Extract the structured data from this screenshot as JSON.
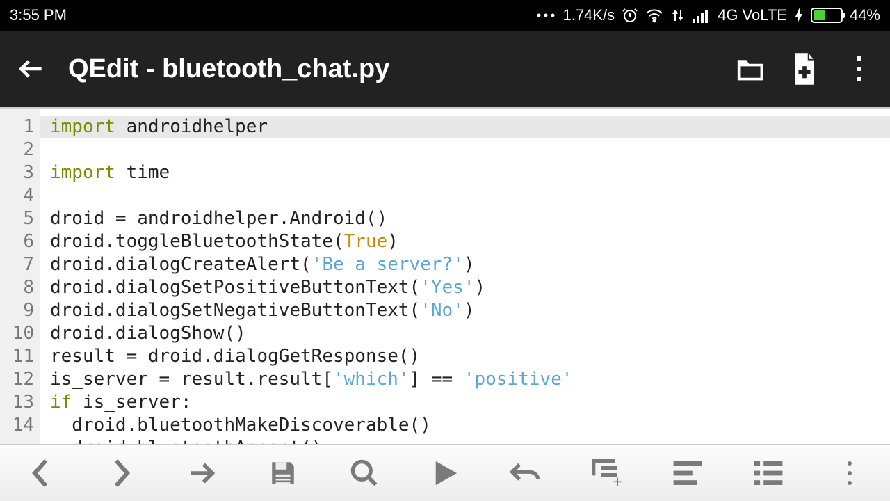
{
  "status": {
    "time": "3:55 PM",
    "speed": "1.74K/s",
    "network_label": "4G VoLTE",
    "battery_pct": "44%",
    "battery_fill_pct": 44
  },
  "appbar": {
    "title": "QEdit - bluetooth_chat.py"
  },
  "code": {
    "lines": [
      {
        "n": 1,
        "segments": [
          {
            "t": "import",
            "c": "kw"
          },
          {
            "t": " androidhelper",
            "c": ""
          }
        ],
        "hl": true
      },
      {
        "n": 2,
        "segments": [
          {
            "t": "import",
            "c": "kw"
          },
          {
            "t": " time",
            "c": ""
          }
        ]
      },
      {
        "n": 3,
        "segments": [
          {
            "t": "",
            "c": ""
          }
        ]
      },
      {
        "n": 4,
        "segments": [
          {
            "t": "droid = androidhelper.Android()",
            "c": ""
          }
        ]
      },
      {
        "n": 5,
        "segments": [
          {
            "t": "droid.toggleBluetoothState(",
            "c": ""
          },
          {
            "t": "True",
            "c": "bool"
          },
          {
            "t": ")",
            "c": ""
          }
        ]
      },
      {
        "n": 6,
        "segments": [
          {
            "t": "droid.dialogCreateAlert(",
            "c": ""
          },
          {
            "t": "'Be a server?'",
            "c": "str"
          },
          {
            "t": ")",
            "c": ""
          }
        ]
      },
      {
        "n": 7,
        "segments": [
          {
            "t": "droid.dialogSetPositiveButtonText(",
            "c": ""
          },
          {
            "t": "'Yes'",
            "c": "str"
          },
          {
            "t": ")",
            "c": ""
          }
        ]
      },
      {
        "n": 8,
        "segments": [
          {
            "t": "droid.dialogSetNegativeButtonText(",
            "c": ""
          },
          {
            "t": "'No'",
            "c": "str"
          },
          {
            "t": ")",
            "c": ""
          }
        ]
      },
      {
        "n": 9,
        "segments": [
          {
            "t": "droid.dialogShow()",
            "c": ""
          }
        ]
      },
      {
        "n": 10,
        "segments": [
          {
            "t": "result = droid.dialogGetResponse()",
            "c": ""
          }
        ]
      },
      {
        "n": 11,
        "segments": [
          {
            "t": "is_server = result.result[",
            "c": ""
          },
          {
            "t": "'which'",
            "c": "str"
          },
          {
            "t": "] == ",
            "c": ""
          },
          {
            "t": "'positive'",
            "c": "str"
          }
        ]
      },
      {
        "n": 12,
        "segments": [
          {
            "t": "if",
            "c": "kw"
          },
          {
            "t": " is_server:",
            "c": ""
          }
        ]
      },
      {
        "n": 13,
        "segments": [
          {
            "t": "  droid.bluetoothMakeDiscoverable()",
            "c": ""
          }
        ]
      },
      {
        "n": 14,
        "segments": [
          {
            "t": "  droid.bluetoothAccept()",
            "c": ""
          }
        ]
      }
    ]
  }
}
